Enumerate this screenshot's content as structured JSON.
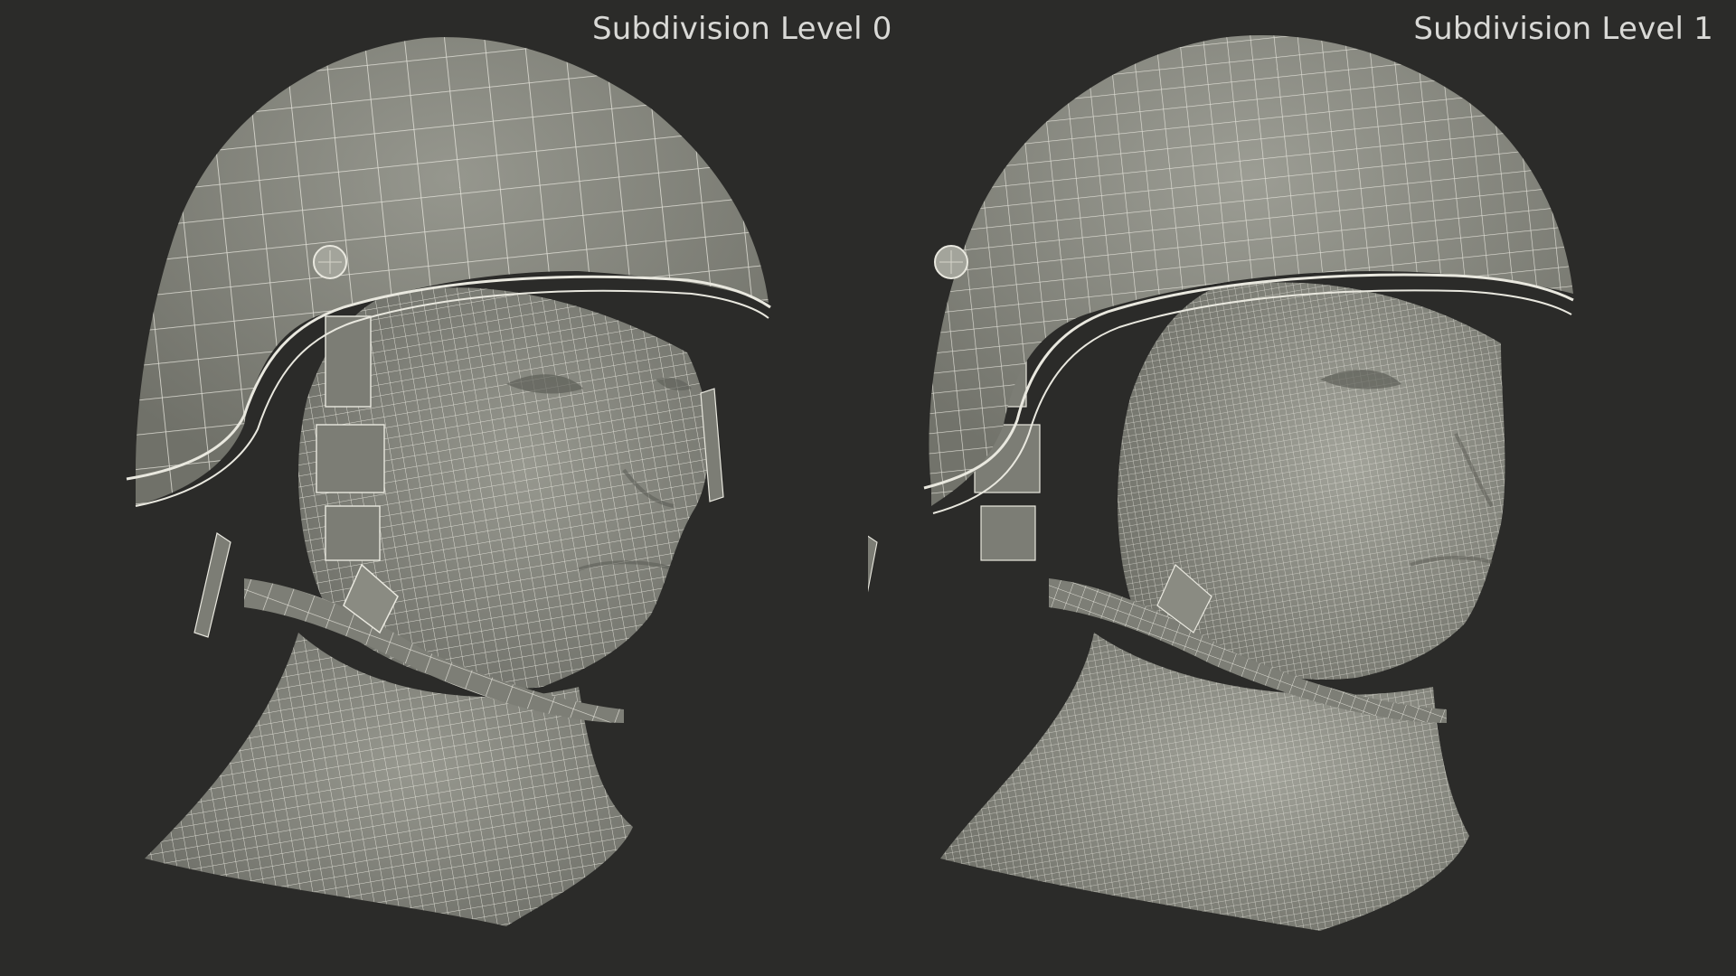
{
  "panels": [
    {
      "label": "Subdivision Level 0"
    },
    {
      "label": "Subdivision Level 1"
    }
  ],
  "colors": {
    "background": "#2b2b29",
    "surface": "#8a8b82",
    "wire": "#e9e8df",
    "label": "#d9d9d6"
  }
}
